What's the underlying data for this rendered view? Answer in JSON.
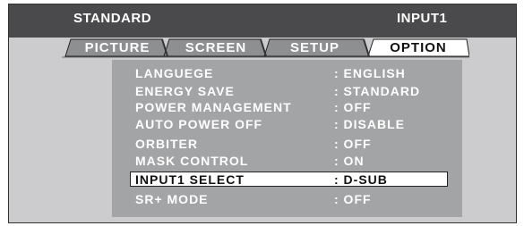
{
  "header": {
    "mode": "STANDARD",
    "input": "INPUT1"
  },
  "tabs": [
    {
      "label": "PICTURE",
      "active": false
    },
    {
      "label": "SCREEN",
      "active": false
    },
    {
      "label": "SETUP",
      "active": false
    },
    {
      "label": "OPTION",
      "active": true
    }
  ],
  "menu": {
    "selected_index": 6,
    "items": [
      {
        "label": "LANGUEGE",
        "value": ": ENGLISH"
      },
      {
        "label": "ENERGY SAVE",
        "value": ": STANDARD"
      },
      {
        "label": "POWER MANAGEMENT",
        "value": ": OFF"
      },
      {
        "label": "AUTO POWER OFF",
        "value": ": DISABLE"
      },
      {
        "label": "ORBITER",
        "value": ": OFF"
      },
      {
        "label": "MASK CONTROL",
        "value": ": ON"
      },
      {
        "label": "INPUT1 SELECT",
        "value": ": D-SUB"
      },
      {
        "label": "SR+ MODE",
        "value": ": OFF"
      }
    ]
  },
  "colors": {
    "header_bg": "#4a4a4c",
    "tab_bg": "#8e8f91",
    "active_tab_bg": "#ffffff",
    "panel_bg": "#a3a4a6",
    "screen_bg": "#ccccce"
  }
}
